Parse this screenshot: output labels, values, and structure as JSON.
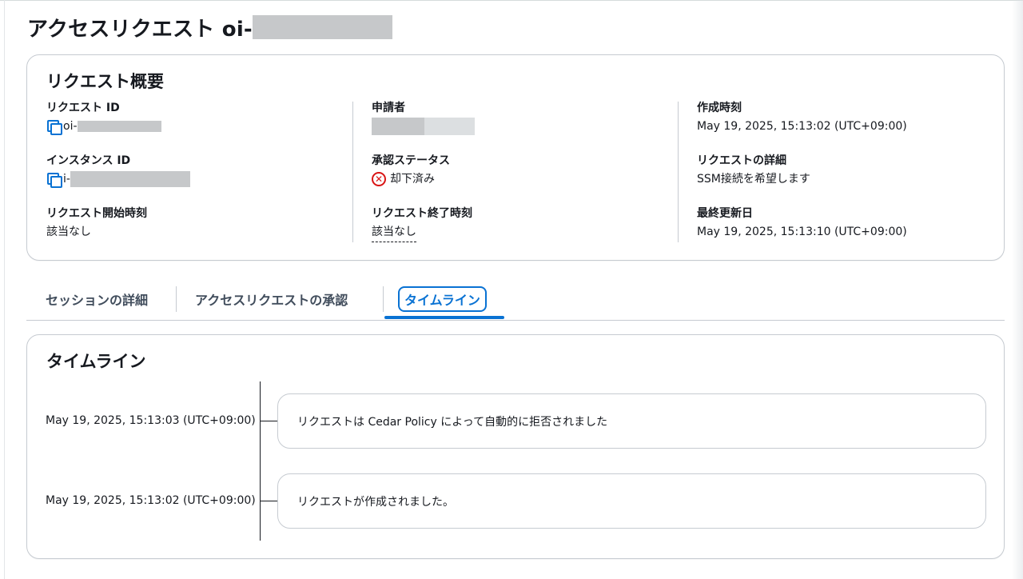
{
  "page": {
    "title": "アクセスリクエスト oi-"
  },
  "summary": {
    "title": "リクエスト概要",
    "request_id": {
      "label": "リクエスト ID",
      "value": "oi-"
    },
    "instance_id": {
      "label": "インスタンス ID",
      "value": "i-"
    },
    "start_time": {
      "label": "リクエスト開始時刻",
      "value": "該当なし"
    },
    "requester": {
      "label": "申請者",
      "value": ""
    },
    "approval_status": {
      "label": "承認ステータス",
      "value": "却下済み",
      "icon": "status-error-icon",
      "color": "#d91515"
    },
    "end_time": {
      "label": "リクエスト終了時刻",
      "value": "該当なし"
    },
    "created_at": {
      "label": "作成時刻",
      "value": "May 19, 2025, 15:13:02 (UTC+09:00)"
    },
    "details": {
      "label": "リクエストの詳細",
      "value": "SSM接続を希望します"
    },
    "updated_at": {
      "label": "最終更新日",
      "value": "May 19, 2025, 15:13:10 (UTC+09:00)"
    }
  },
  "tabs": [
    {
      "label": "セッションの詳細",
      "active": false
    },
    {
      "label": "アクセスリクエストの承認",
      "active": false
    },
    {
      "label": "タイムライン",
      "active": true
    }
  ],
  "timeline": {
    "title": "タイムライン",
    "events": [
      {
        "time": "May 19, 2025, 15:13:03 (UTC+09:00)",
        "message": "リクエストは Cedar Policy によって自動的に拒否されました"
      },
      {
        "time": "May 19, 2025, 15:13:02 (UTC+09:00)",
        "message": "リクエストが作成されました。"
      }
    ]
  },
  "colors": {
    "accent": "#0972d3",
    "error": "#d91515",
    "border": "#c6cbd1",
    "text": "#16191f"
  }
}
